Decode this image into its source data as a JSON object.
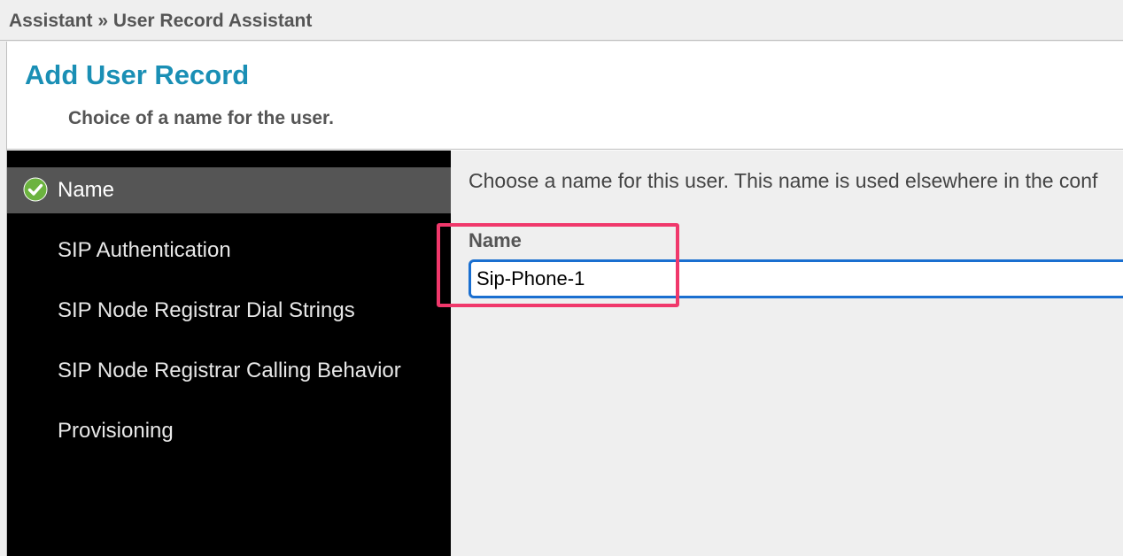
{
  "breadcrumb": {
    "text": "Assistant » User Record Assistant"
  },
  "header": {
    "title": "Add User Record",
    "subtitle": "Choice of a name for the user."
  },
  "sidebar": {
    "items": [
      {
        "label": "Name",
        "active": true,
        "completed": true,
        "icon": "check-circle-icon"
      },
      {
        "label": "SIP Authentication",
        "active": false
      },
      {
        "label": "SIP Node Registrar Dial Strings",
        "active": false
      },
      {
        "label": "SIP Node Registrar Calling Behavior",
        "active": false
      },
      {
        "label": "Provisioning",
        "active": false
      }
    ]
  },
  "main": {
    "description": "Choose a name for this user. This name is used elsewhere in the conf",
    "name_field": {
      "label": "Name",
      "value": "Sip-Phone-1"
    }
  },
  "colors": {
    "title": "#1a8fb5",
    "sidebar_bg": "#000000",
    "sidebar_active": "#555555",
    "check_green": "#6cb33f",
    "input_focus": "#1a6fd0",
    "highlight": "#f0386b"
  }
}
